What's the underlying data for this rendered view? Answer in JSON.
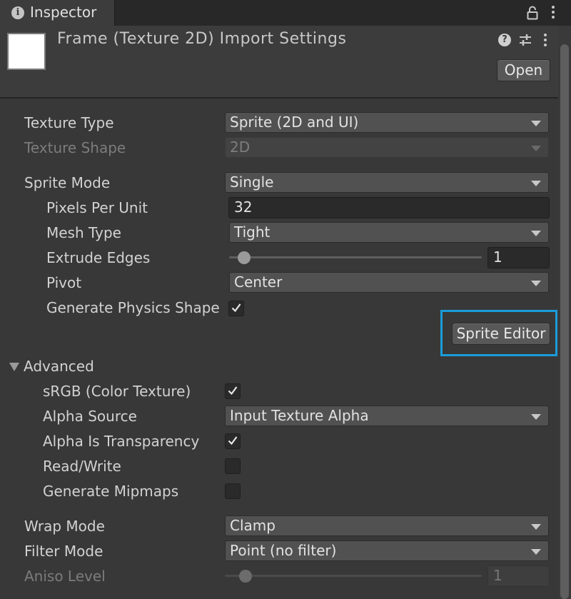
{
  "tab": {
    "title": "Inspector",
    "info_icon": "info-icon"
  },
  "header": {
    "title": "Frame (Texture 2D) Import Settings",
    "open_label": "Open",
    "help_glyph": "?"
  },
  "fields": {
    "texture_type": {
      "label": "Texture Type",
      "value": "Sprite (2D and UI)"
    },
    "texture_shape": {
      "label": "Texture Shape",
      "value": "2D"
    },
    "sprite_mode": {
      "label": "Sprite Mode",
      "value": "Single"
    },
    "pixels_per_unit": {
      "label": "Pixels Per Unit",
      "value": "32"
    },
    "mesh_type": {
      "label": "Mesh Type",
      "value": "Tight"
    },
    "extrude_edges": {
      "label": "Extrude Edges",
      "value": "1",
      "slider_fraction": 0.06
    },
    "pivot": {
      "label": "Pivot",
      "value": "Center"
    },
    "generate_physics_shape": {
      "label": "Generate Physics Shape",
      "checked": true
    },
    "sprite_editor_label": "Sprite Editor"
  },
  "advanced": {
    "label": "Advanced",
    "srgb": {
      "label": "sRGB (Color Texture)",
      "checked": true
    },
    "alpha_source": {
      "label": "Alpha Source",
      "value": "Input Texture Alpha"
    },
    "alpha_is_transparency": {
      "label": "Alpha Is Transparency",
      "checked": true
    },
    "read_write": {
      "label": "Read/Write",
      "checked": false
    },
    "generate_mipmaps": {
      "label": "Generate Mipmaps",
      "checked": false
    }
  },
  "wrap_mode": {
    "label": "Wrap Mode",
    "value": "Clamp"
  },
  "filter_mode": {
    "label": "Filter Mode",
    "value": "Point (no filter)"
  },
  "aniso_level": {
    "label": "Aniso Level",
    "value": "1",
    "slider_fraction": 0.08
  },
  "colors": {
    "highlight": "#1a9cd8",
    "background": "#383838"
  }
}
